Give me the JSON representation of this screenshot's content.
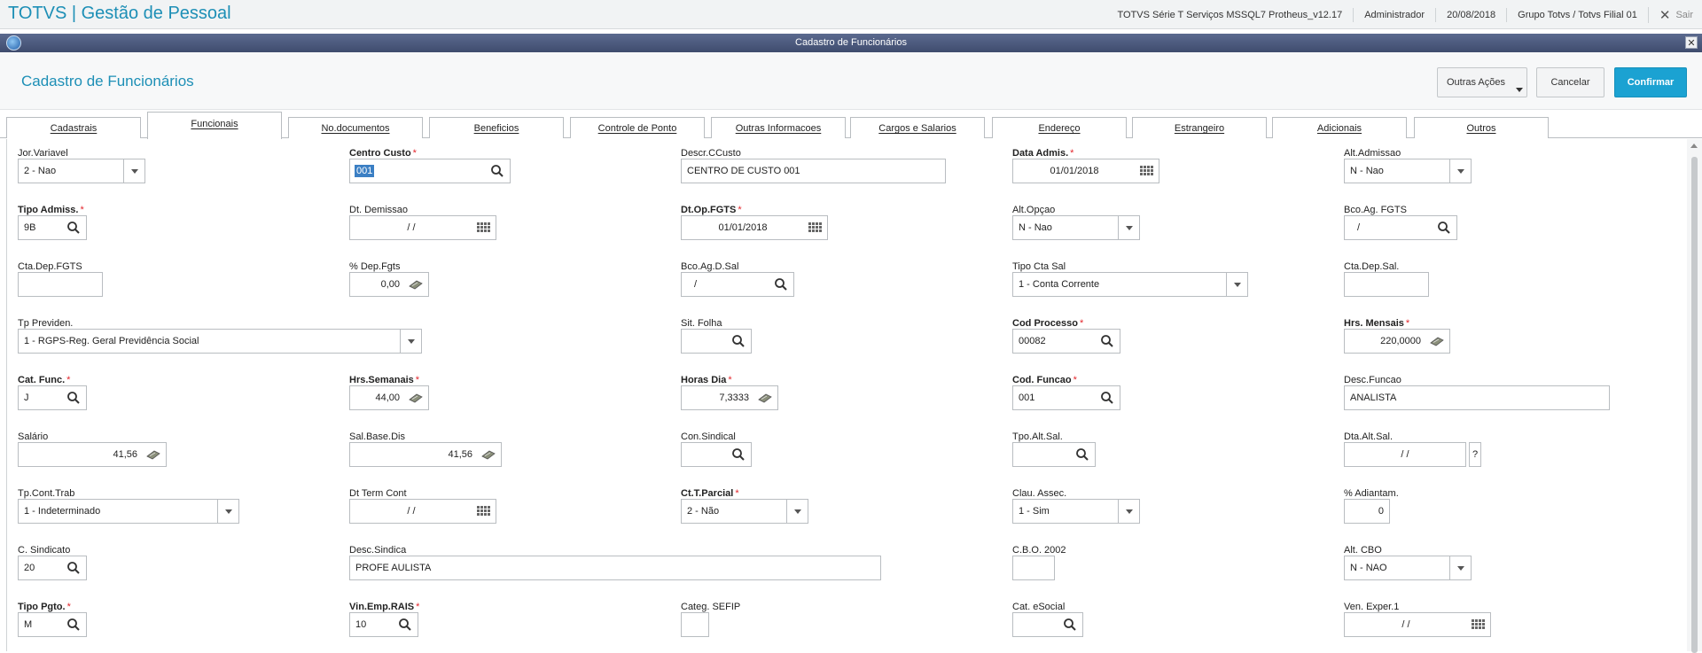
{
  "app": {
    "title": "TOTVS | Gestão de Pessoal",
    "environment": "TOTVS Série T Serviços MSSQL7 Protheus_v12.17",
    "user": "Administrador",
    "date": "20/08/2018",
    "company": "Grupo Totvs / Totvs Filial 01",
    "exit_label": "Sair"
  },
  "window": {
    "title": "Cadastro de Funcionários"
  },
  "header": {
    "title": "Cadastro de Funcionários",
    "other_actions_label": "Outras Ações",
    "cancel_label": "Cancelar",
    "confirm_label": "Confirmar"
  },
  "tabs": [
    "Cadastrais",
    "Funcionais",
    "No.documentos",
    "Beneficios",
    "Controle de Ponto",
    "Outras Informacoes",
    "Cargos e Salarios",
    "Endereço",
    "Estrangeiro",
    "Adicionais",
    "Outros"
  ],
  "active_tab": "Funcionais",
  "fields": {
    "jor_variavel": {
      "label": "Jor.Variavel",
      "value": "2 - Nao"
    },
    "centro_custo": {
      "label": "Centro Custo",
      "value": "001"
    },
    "descr_ccusto": {
      "label": "Descr.CCusto",
      "value": "CENTRO DE CUSTO 001"
    },
    "data_admis": {
      "label": "Data Admis.",
      "value": "01/01/2018"
    },
    "alt_admissao": {
      "label": "Alt.Admissao",
      "value": "N - Nao"
    },
    "tipo_admiss": {
      "label": "Tipo Admiss.",
      "value": "9B"
    },
    "dt_demissao": {
      "label": "Dt. Demissao",
      "value": "/  /"
    },
    "dt_op_fgts": {
      "label": "Dt.Op.FGTS",
      "value": "01/01/2018"
    },
    "alt_opcao": {
      "label": "Alt.Opçao",
      "value": "N - Nao"
    },
    "bco_ag_fgts": {
      "label": "Bco.Ag. FGTS",
      "value": "/"
    },
    "cta_dep_fgts": {
      "label": "Cta.Dep.FGTS",
      "value": ""
    },
    "pct_dep_fgts": {
      "label": "% Dep.Fgts",
      "value": "0,00"
    },
    "bco_ag_d_sal": {
      "label": "Bco.Ag.D.Sal",
      "value": "/"
    },
    "tipo_cta_sal": {
      "label": "Tipo Cta Sal",
      "value": "1 - Conta Corrente"
    },
    "cta_dep_sal": {
      "label": "Cta.Dep.Sal.",
      "value": ""
    },
    "tp_previden": {
      "label": "Tp Previden.",
      "value": "1 - RGPS-Reg. Geral Previdência Social"
    },
    "sit_folha": {
      "label": "Sit. Folha",
      "value": ""
    },
    "cod_processo": {
      "label": "Cod Processo",
      "value": "00082"
    },
    "hrs_mensais": {
      "label": "Hrs. Mensais",
      "value": "220,0000"
    },
    "cat_func": {
      "label": "Cat. Func.",
      "value": "J"
    },
    "hrs_semanais": {
      "label": "Hrs.Semanais",
      "value": "44,00"
    },
    "horas_dia": {
      "label": "Horas Dia",
      "value": "7,3333"
    },
    "cod_funcao": {
      "label": "Cod. Funcao",
      "value": "001"
    },
    "desc_funcao": {
      "label": "Desc.Funcao",
      "value": "ANALISTA"
    },
    "salario": {
      "label": "Salário",
      "value": "41,56"
    },
    "sal_base_dis": {
      "label": "Sal.Base.Dis",
      "value": "41,56"
    },
    "con_sindical": {
      "label": "Con.Sindical",
      "value": ""
    },
    "tpo_alt_sal": {
      "label": "Tpo.Alt.Sal.",
      "value": ""
    },
    "dta_alt_sal": {
      "label": "Dta.Alt.Sal.",
      "value": "/  /"
    },
    "tp_cont_trab": {
      "label": "Tp.Cont.Trab",
      "value": "1 - Indeterminado"
    },
    "dt_term_cont": {
      "label": "Dt Term Cont",
      "value": "/  /"
    },
    "ct_t_parcial": {
      "label": "Ct.T.Parcial",
      "value": "2 - Não"
    },
    "clau_assec": {
      "label": "Clau. Assec.",
      "value": "1 - Sim"
    },
    "pct_adiantam": {
      "label": "% Adiantam.",
      "value": "0"
    },
    "c_sindicato": {
      "label": "C. Sindicato",
      "value": "20"
    },
    "desc_sindica": {
      "label": "Desc.Sindica",
      "value": "PROFE AULISTA"
    },
    "cbo_2002": {
      "label": "C.B.O. 2002",
      "value": ""
    },
    "alt_cbo": {
      "label": "Alt. CBO",
      "value": "N - NAO"
    },
    "tipo_pgto": {
      "label": "Tipo Pgto.",
      "value": "M"
    },
    "vin_emp_rais": {
      "label": "Vin.Emp.RAIS",
      "value": "10"
    },
    "categ_sefip": {
      "label": "Categ. SEFIP",
      "value": ""
    },
    "cat_esocial": {
      "label": "Cat. eSocial",
      "value": ""
    },
    "ven_exper_1": {
      "label": "Ven. Exper.1",
      "value": "/  /"
    }
  },
  "misc": {
    "question_mark": "?",
    "required_mark": "*"
  },
  "icons": {
    "search": "search-icon",
    "calendar": "calendar-icon",
    "calculator": "calculator-icon",
    "dropdown": "chevron-down-icon",
    "close": "close-icon"
  }
}
